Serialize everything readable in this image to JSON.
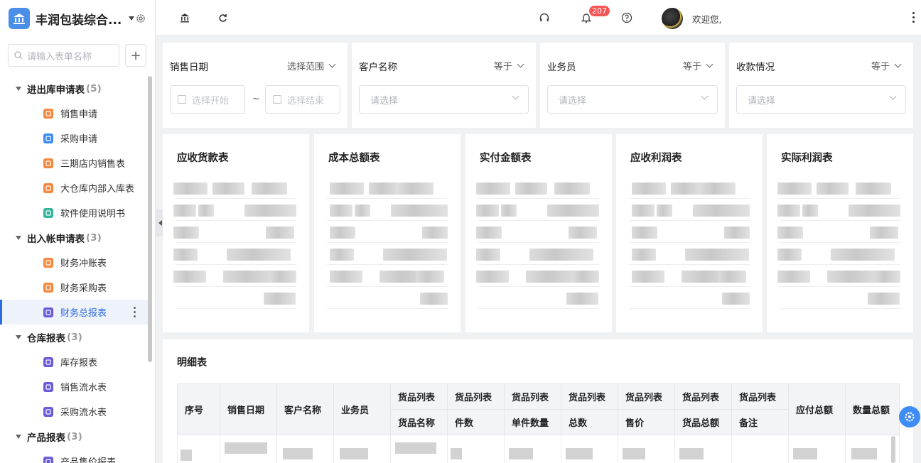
{
  "app": {
    "title": "丰润包装综合...",
    "brand_color": "#4a8fe7"
  },
  "sidebar": {
    "search_placeholder": "请输入表单名称",
    "add_label": "+",
    "groups": [
      {
        "label": "进出库申请表",
        "count": "(5)",
        "items": [
          {
            "label": "销售申请",
            "icon": "truck-icon",
            "color": "#f5883c"
          },
          {
            "label": "采购申请",
            "icon": "cart-icon",
            "color": "#3b8cf3"
          },
          {
            "label": "三期店内销售表",
            "icon": "home-icon",
            "color": "#f5883c"
          },
          {
            "label": "大仓库内部入库表",
            "icon": "form-icon",
            "color": "#f5883c"
          },
          {
            "label": "软件使用说明书",
            "icon": "doc-icon",
            "color": "#33b59b"
          }
        ]
      },
      {
        "label": "出入帐申请表",
        "count": "(3)",
        "items": [
          {
            "label": "财务冲账表",
            "icon": "form-icon",
            "color": "#f5883c"
          },
          {
            "label": "财务采购表",
            "icon": "form-icon",
            "color": "#f5883c"
          },
          {
            "label": "财务总报表",
            "icon": "report-icon",
            "color": "#6b5ad9",
            "active": true
          }
        ]
      },
      {
        "label": "仓库报表",
        "count": "(3)",
        "items": [
          {
            "label": "库存报表",
            "icon": "list-icon",
            "color": "#6b5ad9"
          },
          {
            "label": "销售流水表",
            "icon": "chart-icon",
            "color": "#6b5ad9"
          },
          {
            "label": "采购流水表",
            "icon": "chart-icon",
            "color": "#6b5ad9"
          }
        ]
      },
      {
        "label": "产品报表",
        "count": "(3)",
        "items": [
          {
            "label": "产品售价报表",
            "icon": "pie-icon",
            "color": "#6b5ad9"
          }
        ]
      }
    ]
  },
  "topbar": {
    "notification_count": "207",
    "welcome": "欢迎您,"
  },
  "filters": [
    {
      "label": "销售日期",
      "op": "选择范围",
      "start_placeholder": "选择开始",
      "end_placeholder": "选择结束",
      "separator": "~"
    },
    {
      "label": "客户名称",
      "op": "等于",
      "placeholder": "请选择"
    },
    {
      "label": "业务员",
      "op": "等于",
      "placeholder": "请选择"
    },
    {
      "label": "收款情况",
      "op": "等于",
      "placeholder": "请选择"
    }
  ],
  "cards": [
    {
      "title": "应收货款表"
    },
    {
      "title": "成本总额表"
    },
    {
      "title": "实付金额表"
    },
    {
      "title": "应收利润表"
    },
    {
      "title": "实际利润表"
    }
  ],
  "detail": {
    "title": "明细表",
    "headers_single": [
      "序号",
      "销售日期",
      "客户名称",
      "业务员"
    ],
    "group_label": "货品列表",
    "headers_sub": [
      "货品名称",
      "件数",
      "单件数量",
      "总数",
      "售价",
      "货品总额",
      "备注"
    ],
    "headers_tail": [
      "应付总额",
      "数量总额"
    ]
  }
}
